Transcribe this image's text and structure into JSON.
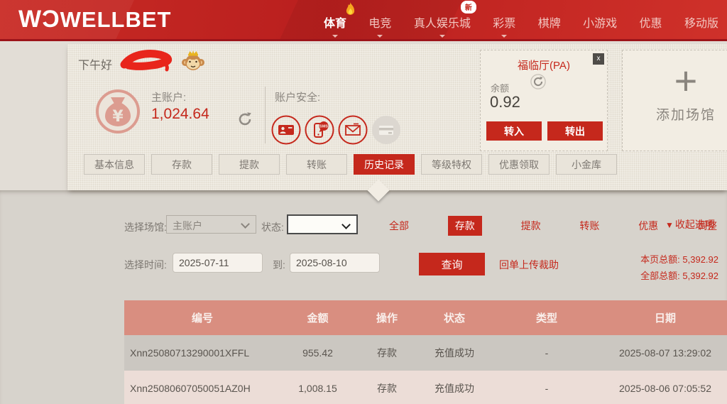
{
  "colors": {
    "accent_red": "#c5281c",
    "nav_red": "#c22823",
    "table_header_bg": "#d98e80",
    "row_odd_bg": "#cbc7c1",
    "row_even_bg": "#ecddd7",
    "panel_beige": "#ece7dd"
  },
  "nav": {
    "logo_mark": "WƆ",
    "logo_text": "WELLBET",
    "items": [
      {
        "label": "体育",
        "active": true,
        "hot": true,
        "caret": true
      },
      {
        "label": "电竞",
        "caret": true
      },
      {
        "label": "真人娱乐城",
        "badge": "新",
        "caret": true
      },
      {
        "label": "彩票",
        "caret": true
      },
      {
        "label": "棋牌"
      },
      {
        "label": "小游戏"
      },
      {
        "label": "优惠"
      },
      {
        "label": "移动版"
      }
    ]
  },
  "greeting": {
    "text": "下午好",
    "avatar_icon": "monkey-face",
    "name_icon": "red-scribble-redaction"
  },
  "account": {
    "main_label": "主账户:",
    "main_balance": "1,024.64",
    "security_label": "账户安全:",
    "security_icons": [
      "id-card-icon",
      "sms-phone-icon",
      "mail-icon",
      "bank-card-icon"
    ]
  },
  "venue_card": {
    "title": "福临厅(PA)",
    "close": "x",
    "balance_label": "余额",
    "balance": "0.92",
    "transfer_in": "转入",
    "transfer_out": "转出"
  },
  "add_venue": {
    "plus": "+",
    "label": "添加场馆"
  },
  "tabs": [
    {
      "label": "基本信息"
    },
    {
      "label": "存款"
    },
    {
      "label": "提款"
    },
    {
      "label": "转账"
    },
    {
      "label": "历史记录",
      "active": true
    },
    {
      "label": "等级特权"
    },
    {
      "label": "优惠领取"
    },
    {
      "label": "小金库"
    }
  ],
  "filters": {
    "venue_label": "选择场馆:",
    "venue_value": "主账户",
    "status_label": "状态:",
    "status_value": "",
    "type_links": [
      {
        "label": "全部"
      },
      {
        "label": "存款",
        "active": true
      },
      {
        "label": "提款"
      },
      {
        "label": "转账"
      },
      {
        "label": "优惠"
      },
      {
        "label": "调整"
      }
    ],
    "collapse_icon": "▼",
    "collapse_label": "收起选项",
    "time_label": "选择时间:",
    "date_from": "2025-07-11",
    "to_label": "到:",
    "date_to": "2025-08-10",
    "search_label": "查询",
    "receipt_link": "回单上传裁助",
    "page_total_label": "本页总额:",
    "page_total": "5,392.92",
    "all_total_label": "全部总额:",
    "all_total": "5,392.92"
  },
  "table": {
    "headers": [
      "编号",
      "金额",
      "操作",
      "状态",
      "类型",
      "日期"
    ],
    "rows": [
      [
        "Xnn25080713290001XFFL",
        "955.42",
        "存款",
        "充值成功",
        "-",
        "2025-08-07 13:29:02"
      ],
      [
        "Xnn25080607050051AZ0H",
        "1,008.15",
        "存款",
        "充值成功",
        "-",
        "2025-08-06 07:05:52"
      ]
    ]
  }
}
